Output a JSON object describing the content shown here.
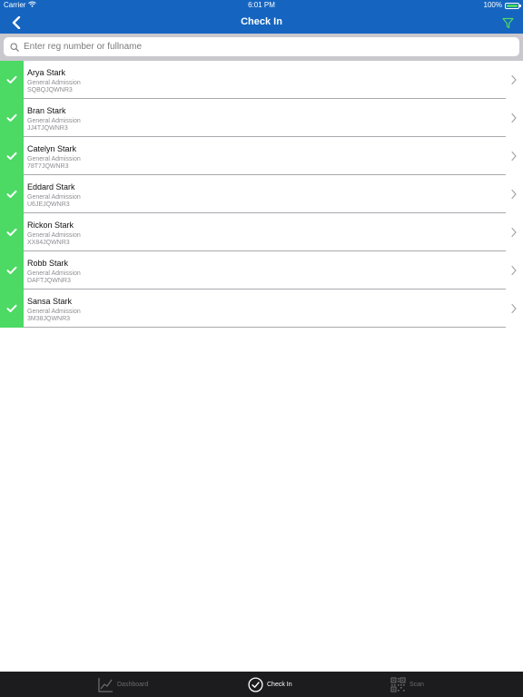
{
  "status_bar": {
    "carrier": "Carrier",
    "time": "6:01 PM",
    "battery": "100%",
    "battery_level": 1.0
  },
  "nav": {
    "title": "Check In",
    "back_icon": "chevron-left-icon",
    "filter_icon": "filter-icon"
  },
  "search": {
    "placeholder": "Enter reg number or fullname",
    "value": ""
  },
  "attendees": [
    {
      "name": "Arya Stark",
      "type": "General Admission",
      "code": "SQBQJQWNR3",
      "checked_in": true
    },
    {
      "name": "Bran Stark",
      "type": "General Admission",
      "code": "JJ4TJQWNR3",
      "checked_in": true
    },
    {
      "name": "Catelyn Stark",
      "type": "General Admission",
      "code": "78T7JQWNR3",
      "checked_in": true
    },
    {
      "name": "Eddard Stark",
      "type": "General Admission",
      "code": "U6JEJQWNR3",
      "checked_in": true
    },
    {
      "name": "Rickon Stark",
      "type": "General Admission",
      "code": "XX84JQWNR3",
      "checked_in": true
    },
    {
      "name": "Robb Stark",
      "type": "General Admission",
      "code": "DAFTJQWNR3",
      "checked_in": true
    },
    {
      "name": "Sansa Stark",
      "type": "General Admission",
      "code": "3M38JQWNR3",
      "checked_in": true
    }
  ],
  "tabs": [
    {
      "label": "Dashboard",
      "icon": "chart-icon",
      "active": false
    },
    {
      "label": "Check In",
      "icon": "check-circle-icon",
      "active": true
    },
    {
      "label": "Scan",
      "icon": "qr-code-icon",
      "active": false
    }
  ],
  "colors": {
    "header": "#1565c0",
    "checked_in": "#4cd964",
    "filter": "#4cd964",
    "tab_bar": "#1c1c1e"
  }
}
